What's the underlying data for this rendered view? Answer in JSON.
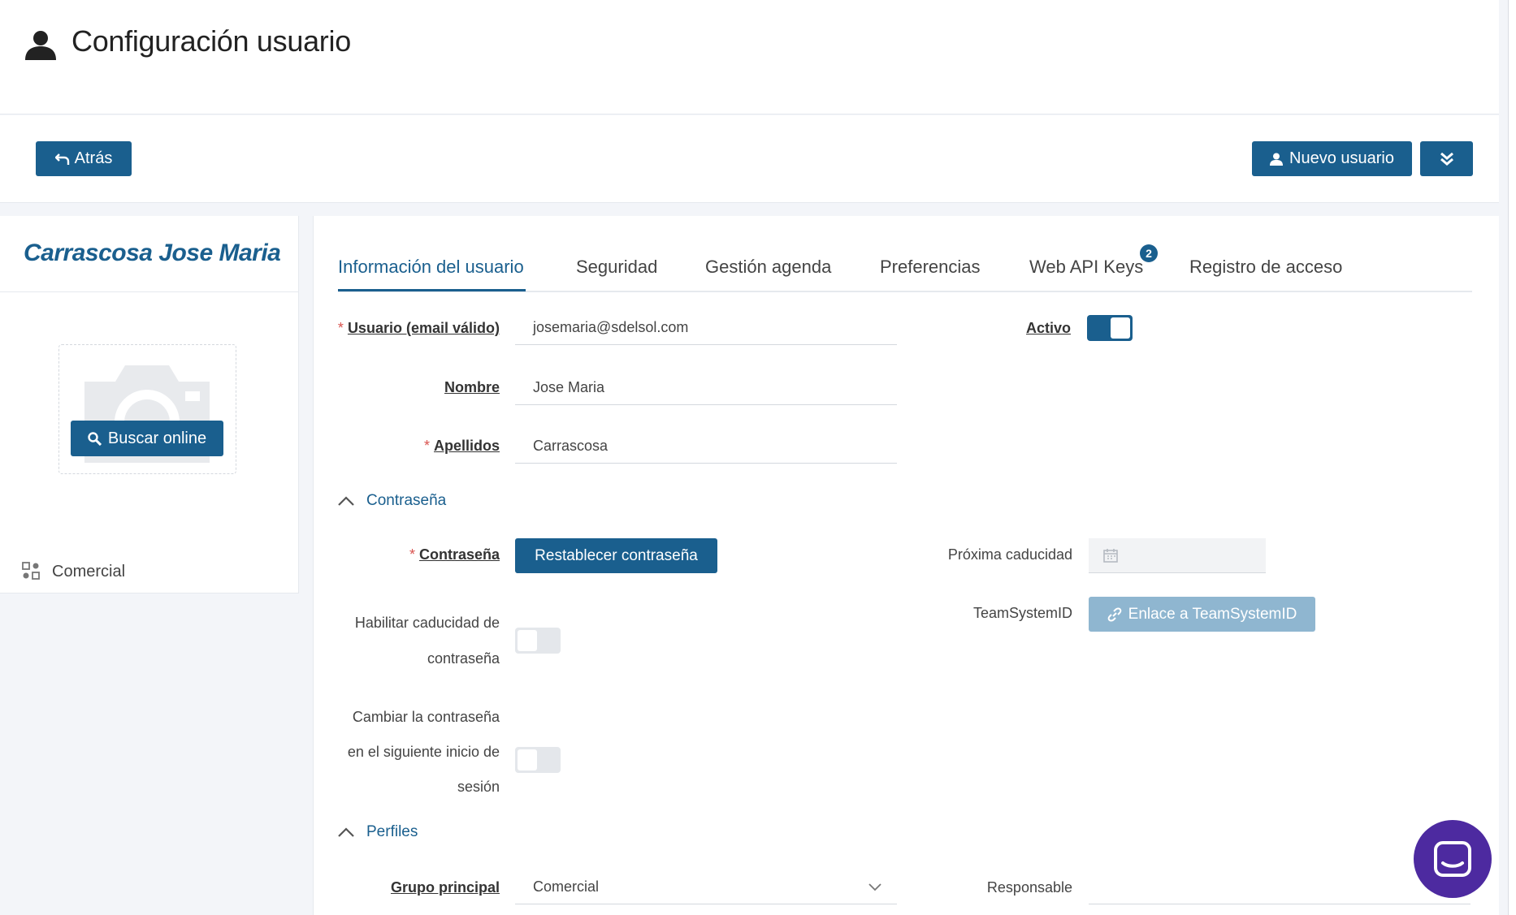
{
  "header": {
    "title": "Configuración usuario",
    "icon": "user-icon"
  },
  "toolbar": {
    "back_label": "Atrás",
    "new_user_label": "Nuevo usuario",
    "more_icon": "double-chevron-down-icon"
  },
  "profile": {
    "full_name": "Carrascosa Jose Maria",
    "photo_icon": "camera-icon",
    "search_online_label": "Buscar online",
    "group_label": "Comercial",
    "group_icon": "group-icon"
  },
  "tabs": [
    {
      "label": "Información del usuario",
      "active": true
    },
    {
      "label": "Seguridad"
    },
    {
      "label": "Gestión agenda"
    },
    {
      "label": "Preferencias"
    },
    {
      "label": "Web API Keys",
      "badge": "2"
    },
    {
      "label": "Registro de acceso"
    }
  ],
  "form": {
    "usuario": {
      "label": "Usuario (email válido)",
      "value": "josemaria@sdelsol.com"
    },
    "activo": {
      "label": "Activo",
      "checked": true
    },
    "nombre": {
      "label": "Nombre",
      "value": "Jose Maria"
    },
    "apellidos": {
      "label": "Apellidos",
      "value": "Carrascosa"
    }
  },
  "password_section": {
    "title": "Contraseña",
    "label": "Contraseña",
    "reset_label": "Restablecer contraseña",
    "next_expiry_label": "Próxima caducidad",
    "next_expiry_value": "",
    "teamsystem_label": "TeamSystemID",
    "teamsystem_link_label": "Enlace a TeamSystemID",
    "expiry_toggle_label": [
      "Habilitar caducidad de",
      "contraseña"
    ],
    "expiry_toggle_checked": false,
    "change_next_login_label": [
      "Cambiar la contraseña",
      "en el siguiente inicio de",
      "sesión"
    ],
    "change_next_login_checked": false
  },
  "profiles_section": {
    "title": "Perfiles",
    "grupo_principal_label": "Grupo principal",
    "grupo_principal_value": "Comercial",
    "responsable_label": "Responsable",
    "responsable_value": ""
  },
  "colors": {
    "accent": "#1a5f8e",
    "required": "#d9534f",
    "chat": "#4d2aa0"
  }
}
